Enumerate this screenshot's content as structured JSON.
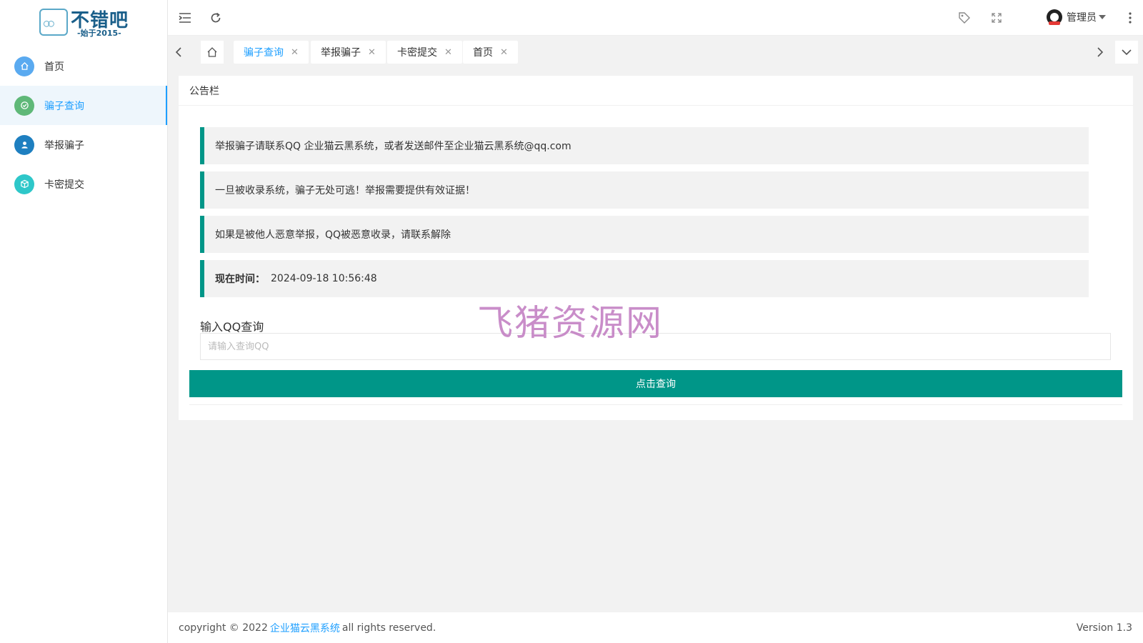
{
  "logo": {
    "title": "不错吧",
    "subtitle": "-始于2015-"
  },
  "sidebar": {
    "items": [
      {
        "label": "首页",
        "icon": "home-icon",
        "color": "#5aaaf0"
      },
      {
        "label": "骗子查询",
        "icon": "shield-check-icon",
        "color": "#5fb878",
        "active": true
      },
      {
        "label": "举报骗子",
        "icon": "user-icon",
        "color": "#1e7fc0"
      },
      {
        "label": "卡密提交",
        "icon": "cube-icon",
        "color": "#2ec7c9"
      }
    ]
  },
  "header": {
    "user_name": "管理员"
  },
  "tabs": [
    {
      "label": "骗子查询",
      "active": true
    },
    {
      "label": "举报骗子"
    },
    {
      "label": "卡密提交"
    },
    {
      "label": "首页"
    }
  ],
  "card": {
    "title": "公告栏",
    "notices": [
      "举报骗子请联系QQ 企业猫云黑系统，或者发送邮件至企业猫云黑系统@qq.com",
      "一旦被收录系统，骗子无处可逃！举报需要提供有效证据！",
      "如果是被他人恶意举报，QQ被恶意收录，请联系解除"
    ],
    "time_label": "现在时间：",
    "time_value": "2024-09-18 10:56:48",
    "qq_label": "输入QQ查询",
    "qq_placeholder": "请输入查询QQ",
    "submit_label": "点击查询"
  },
  "watermark": "飞猪资源网",
  "footer": {
    "prefix": "copyright © 2022",
    "link": "企业猫云黑系统",
    "suffix": "all rights reserved.",
    "version": "Version 1.3"
  },
  "colors": {
    "accent": "#009688",
    "link": "#1e9fff"
  }
}
